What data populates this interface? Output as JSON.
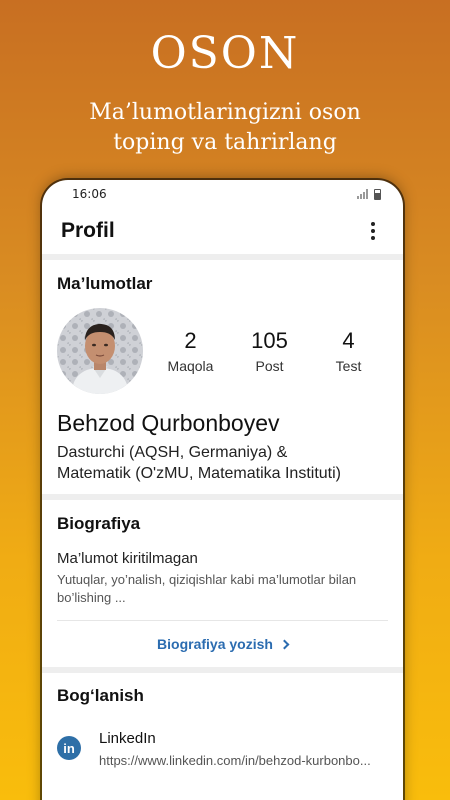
{
  "promo": {
    "title": "OSON",
    "subtitle_line1": "Ma’lumotlaringizni oson",
    "subtitle_line2": "toping va tahrirlang"
  },
  "status_bar": {
    "time": "16:06"
  },
  "app_bar": {
    "title": "Profil",
    "menu_icon": "more-vert-icon"
  },
  "info": {
    "title": "Ma’lumotlar",
    "stats": [
      {
        "value": "2",
        "label": "Maqola"
      },
      {
        "value": "105",
        "label": "Post"
      },
      {
        "value": "4",
        "label": "Test"
      }
    ],
    "name": "Behzod Qurbonboyev",
    "role_line1": "Dasturchi (AQSH, Germaniya) &",
    "role_line2": "Matematik (O'zMU, Matematika Instituti)"
  },
  "bio": {
    "title": "Biografiya",
    "empty_text": "Ma’lumot kiritilmagan",
    "hint_line1": "Yutuqlar, yo’nalish, qiziqishlar kabi ma’lumotlar bilan",
    "hint_line2": "bo’lishing ...",
    "write_link": "Biografiya yozish"
  },
  "contact": {
    "title": "Bog‘lanish",
    "items": [
      {
        "icon": "in",
        "name": "LinkedIn",
        "url": "https://www.linkedin.com/in/behzod-kurbonbo..."
      }
    ]
  },
  "colors": {
    "accent": "#2b6cb0",
    "linkedin": "#2e6fa7",
    "bg_top": "#c86f22",
    "bg_bottom": "#f9bd0c"
  }
}
